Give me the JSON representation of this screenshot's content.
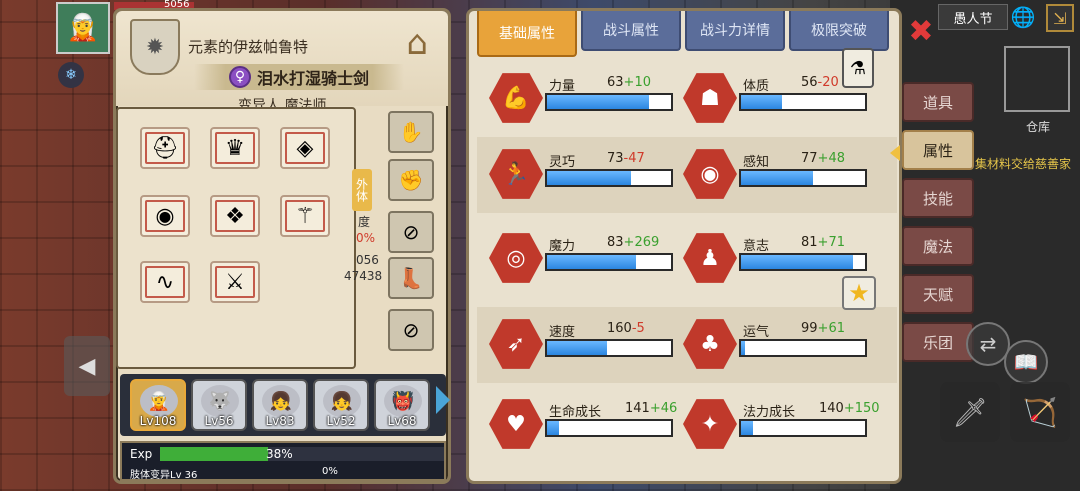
{
  "character": {
    "name": "元素的伊兹帕鲁特",
    "weapon_name": "泪水打湿骑士剑",
    "gender_symbol": "♀",
    "class": "变异人 魔法师",
    "hp_text": "5056",
    "avatar_icon": "elf-girl"
  },
  "equipment_side": {
    "badge": "外体",
    "partial_texts": [
      "度",
      "0%",
      "056",
      "47438"
    ]
  },
  "party": [
    {
      "level": "Lv108",
      "selected": true
    },
    {
      "level": "Lv56",
      "selected": false
    },
    {
      "level": "Lv83",
      "selected": false
    },
    {
      "level": "Lv52",
      "selected": false
    },
    {
      "level": "Lv68",
      "selected": false
    }
  ],
  "exp": {
    "label": "Exp",
    "percent": "38%",
    "fill": 0.38,
    "mutation_label": "肢体变异Lv 36",
    "mutation_percent": "0%"
  },
  "tabs": [
    "基础属性",
    "战斗属性",
    "战斗力详情",
    "极限突破"
  ],
  "attributes": [
    {
      "name": "力量",
      "base": "63",
      "mod": "+10",
      "sign": "plus",
      "fill": 0.82,
      "icon": "muscle-icon"
    },
    {
      "name": "体质",
      "base": "56",
      "mod": "-20",
      "sign": "minus",
      "fill": 0.33,
      "icon": "body-icon"
    },
    {
      "name": "灵巧",
      "base": "73",
      "mod": "-47",
      "sign": "minus",
      "fill": 0.68,
      "icon": "run-icon"
    },
    {
      "name": "感知",
      "base": "77",
      "mod": "+48",
      "sign": "plus",
      "fill": 0.58,
      "icon": "eye-icon"
    },
    {
      "name": "魔力",
      "base": "83",
      "mod": "+269",
      "sign": "plus",
      "fill": 0.72,
      "icon": "swirl-icon"
    },
    {
      "name": "意志",
      "base": "81",
      "mod": "+71",
      "sign": "plus",
      "fill": 0.9,
      "icon": "will-icon"
    },
    {
      "name": "速度",
      "base": "160",
      "mod": "-5",
      "sign": "minus",
      "fill": 0.48,
      "icon": "speed-icon"
    },
    {
      "name": "运气",
      "base": "99",
      "mod": "+61",
      "sign": "plus",
      "fill": 0.03,
      "icon": "clover-icon"
    },
    {
      "name": "生命成长",
      "base": "141",
      "mod": "+46",
      "sign": "plus",
      "fill": 0.1,
      "icon": "heart-icon"
    },
    {
      "name": "法力成长",
      "base": "140",
      "mod": "+150",
      "sign": "plus",
      "fill": 0.1,
      "icon": "mana-icon"
    }
  ],
  "side_menu": [
    {
      "label": "道具",
      "active": false
    },
    {
      "label": "属性",
      "active": true
    },
    {
      "label": "技能",
      "active": false
    },
    {
      "label": "魔法",
      "active": false
    },
    {
      "label": "天赋",
      "active": false
    },
    {
      "label": "乐团",
      "active": false
    }
  ],
  "hud": {
    "top_label": "愚人节",
    "storage_label": "仓库",
    "scroll_text": "集材料交给慈善家"
  },
  "colors": {
    "accent_tab": "#e8a33a",
    "hex_red": "#c0392b",
    "bar_blue": "#2c86e0",
    "plus": "#3aa02e",
    "minus": "#d03a2a"
  }
}
